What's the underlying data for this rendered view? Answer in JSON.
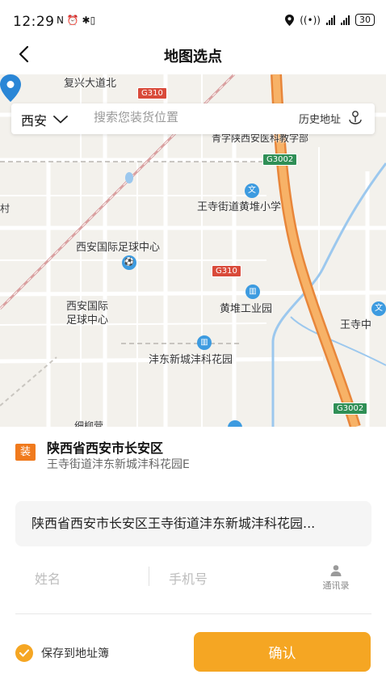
{
  "status_bar": {
    "time": "12:29",
    "left_icons": "N ⏰ ✱▯",
    "network_label": "((•))",
    "battery": "30"
  },
  "nav": {
    "title": "地图选点",
    "back_icon": "chevron-left-icon"
  },
  "search": {
    "city": "西安",
    "placeholder": "搜索您装货位置",
    "history_label": "历史地址"
  },
  "map": {
    "labels": {
      "fuxing": "复兴大道北",
      "school_partial": "青字陕西安医科教字部",
      "wangsi_school": "王寺街道黄堆小学",
      "football_center": "西安国际足球中心",
      "football_center_2a": "西安国际",
      "football_center_2b": "足球中心",
      "huangdui_park": "黄堆工业园",
      "wangsi_right": "王寺中",
      "fengdong": "沣东新城沣科花园",
      "cun": "村",
      "bottom_partial": "细柳营"
    },
    "roads": {
      "g310_top": "G310",
      "g3002_top": "G3002",
      "g310_mid": "G310",
      "g3002_bottom": "G3002"
    },
    "poi_symbols": {
      "culture": "文",
      "building": "▥"
    }
  },
  "address": {
    "badge": "装",
    "title": "陕西省西安市长安区",
    "subtitle": "王寺街道沣东新城沣科花园E",
    "full": "陕西省西安市长安区王寺街道沣东新城沣科花园..."
  },
  "contact": {
    "name_placeholder": "姓名",
    "phone_placeholder": "手机号",
    "contacts_label": "通讯录"
  },
  "footer": {
    "save_label": "保存到地址簿",
    "save_checked": true,
    "confirm_label": "确认"
  },
  "colors": {
    "accent": "#f5a623",
    "badge_orange": "#f07a1d",
    "highway": "#f39a3e",
    "river": "#9cc8ee"
  }
}
